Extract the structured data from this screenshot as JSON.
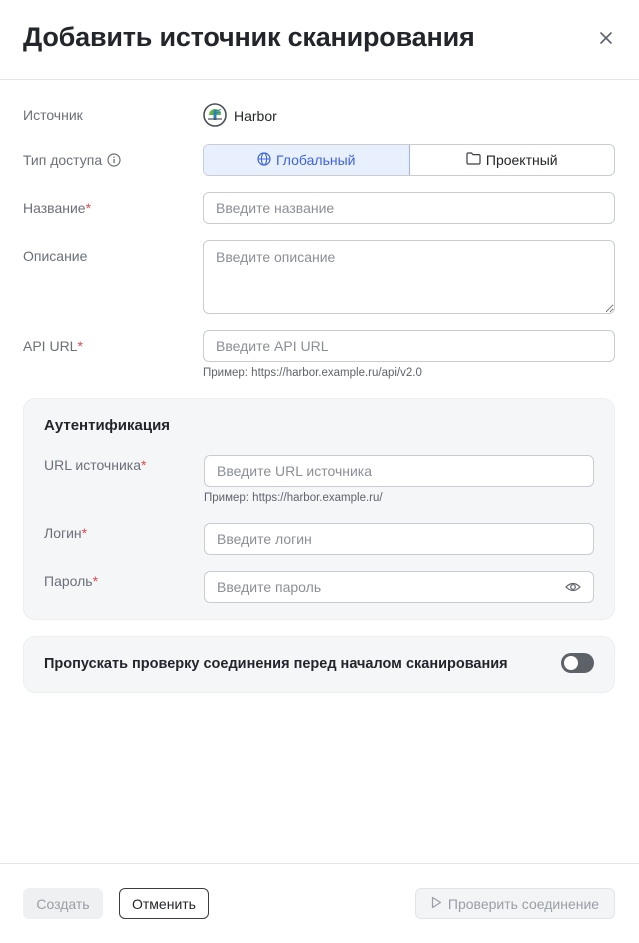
{
  "dialog": {
    "title": "Добавить источник сканирования",
    "close_icon": "close-icon"
  },
  "form": {
    "source": {
      "label": "Источник",
      "value": "Harbor",
      "icon": "harbor-logo"
    },
    "access_type": {
      "label": "Тип доступа",
      "info_icon": "info-icon",
      "options": [
        {
          "label": "Глобальный",
          "icon": "globe-icon",
          "selected": true
        },
        {
          "label": "Проектный",
          "icon": "folder-icon",
          "selected": false
        }
      ]
    },
    "name": {
      "label": "Название",
      "required_mark": "*",
      "value": "",
      "placeholder": "Введите название"
    },
    "description": {
      "label": "Описание",
      "value": "",
      "placeholder": "Введите описание"
    },
    "api_url": {
      "label": "API URL",
      "required_mark": "*",
      "value": "",
      "placeholder": "Введите API URL",
      "hint": "Пример: https://harbor.example.ru/api/v2.0"
    }
  },
  "auth": {
    "title": "Аутентификация",
    "source_url": {
      "label": "URL источника",
      "required_mark": "*",
      "value": "",
      "placeholder": "Введите URL источника",
      "hint": "Пример: https://harbor.example.ru/"
    },
    "login": {
      "label": "Логин",
      "required_mark": "*",
      "value": "",
      "placeholder": "Введите логин"
    },
    "password": {
      "label": "Пароль",
      "required_mark": "*",
      "value": "",
      "placeholder": "Введите пароль",
      "reveal_icon": "eye-icon"
    }
  },
  "skip_check": {
    "label": "Пропускать проверку соединения перед началом сканирования",
    "enabled": false
  },
  "footer": {
    "create_label": "Создать",
    "cancel_label": "Отменить",
    "check_label": "Проверить соединение",
    "check_icon": "play-icon"
  },
  "colors": {
    "accent": "#3e63dd",
    "accent_bg": "#e8f0fd",
    "required": "#e5484d",
    "panel_bg": "#f5f6f8",
    "toggle_off": "#5d6168"
  }
}
